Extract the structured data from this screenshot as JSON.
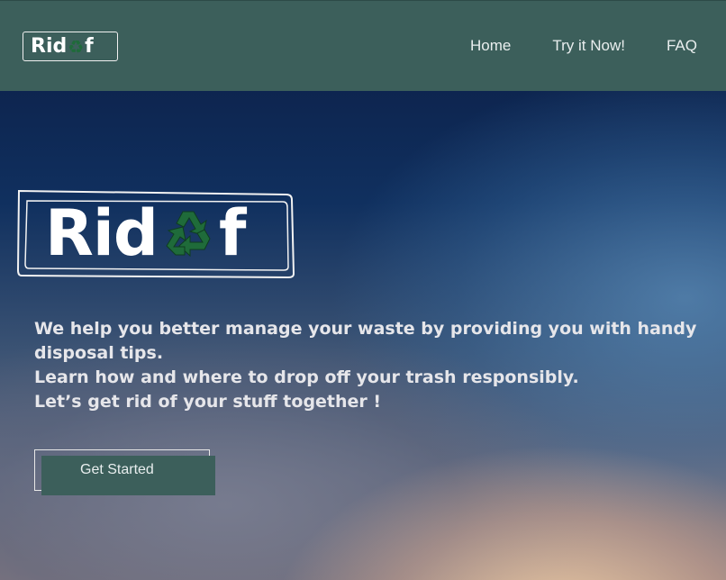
{
  "brand": {
    "name_prefix": "Rid",
    "name_suffix": "f",
    "logo_icon": "recycle-icon",
    "colors": {
      "nav": "#3c5f5b",
      "recycle": "#1f6b3a"
    }
  },
  "nav": {
    "links": [
      {
        "label": "Home"
      },
      {
        "label": "Try it Now!"
      },
      {
        "label": "FAQ"
      }
    ]
  },
  "hero": {
    "lines": [
      "We help you better manage your waste by providing you with handy disposal tips.",
      "Learn how and where to drop off your trash responsibly.",
      "Let’s get rid of your stuff together !"
    ],
    "cta_label": "Get Started"
  }
}
